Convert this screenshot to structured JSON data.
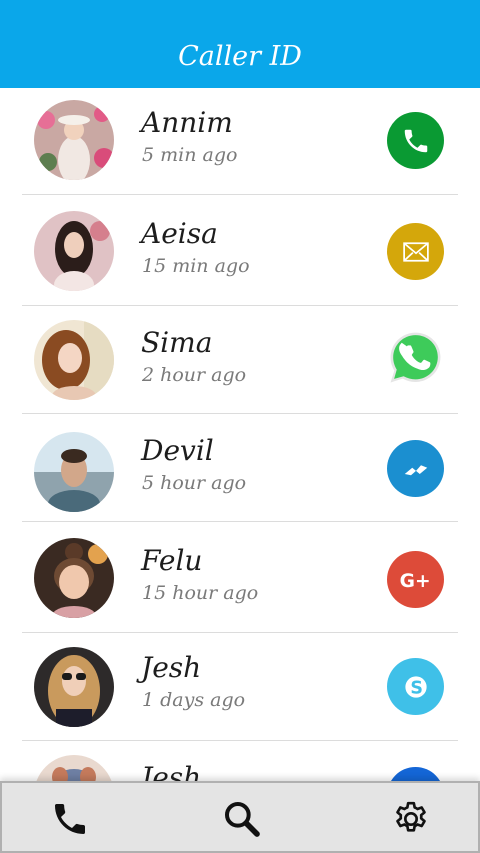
{
  "header": {
    "title": "Caller ID",
    "color": "#0aa7ea"
  },
  "contacts": [
    {
      "name": "Annim",
      "time": "5 min ago",
      "action": "phone-icon",
      "action_color": "#0a9a33"
    },
    {
      "name": "Aeisa",
      "time": "15 min ago",
      "action": "mail-icon",
      "action_color": "#d4a70b"
    },
    {
      "name": "Sima",
      "time": "2 hour ago",
      "action": "whatsapp-icon",
      "action_color": "#3ecb5a"
    },
    {
      "name": "Devil",
      "time": "5 hour ago",
      "action": "messenger-icon",
      "action_color": "#1b8fd0"
    },
    {
      "name": "Felu",
      "time": "15 hour ago",
      "action": "google-plus-icon",
      "action_color": "#dd4b39"
    },
    {
      "name": "Jesh",
      "time": "1 days ago",
      "action": "skype-icon",
      "action_color": "#3fc0e8"
    },
    {
      "name": "Jesh",
      "time": "",
      "action": "facebook-icon",
      "action_color": "#1466d6"
    }
  ],
  "bottom_nav": [
    {
      "icon": "phone-icon"
    },
    {
      "icon": "search-icon"
    },
    {
      "icon": "gear-icon"
    }
  ]
}
